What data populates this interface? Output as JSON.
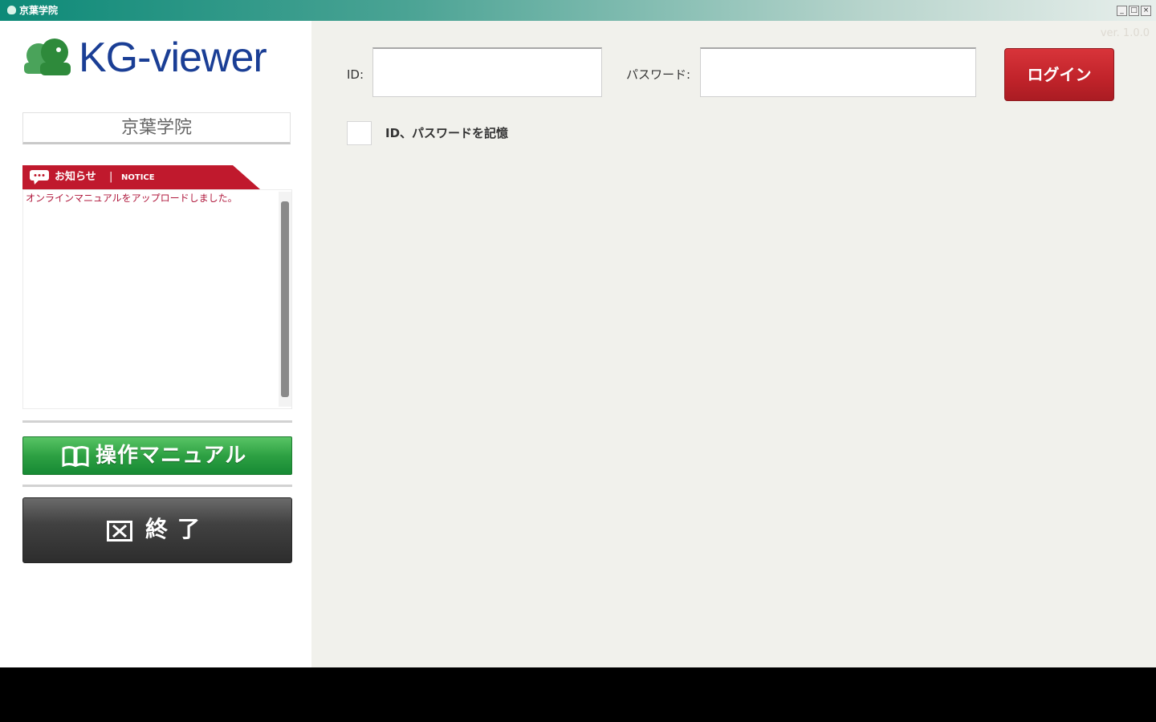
{
  "window": {
    "title": "京葉学院",
    "minimize_glyph": "_",
    "maximize_glyph": "□",
    "close_glyph": "×"
  },
  "sidebar": {
    "logo_text": "KG-viewer",
    "school_name": "京葉学院",
    "notice": {
      "tab_label": "お知らせ",
      "tab_separator": "|",
      "tab_label_en": "NOTICE",
      "messages": [
        "オンラインマニュアルをアップロードしました。"
      ]
    },
    "manual_button_label": "操作マニュアル",
    "exit_button_label": "終了"
  },
  "main": {
    "version": "ver. 1.0.0",
    "id_label": "ID:",
    "id_value": "",
    "password_label": "パスワード:",
    "password_value": "",
    "login_button_label": "ログイン",
    "remember_label": "ID、パスワードを記憶",
    "remember_checked": false
  },
  "colors": {
    "titlebar": "#0d8a78",
    "logo_text": "#1a3e95",
    "logo_mark": "#2e8a3b",
    "notice_header": "#c0192d",
    "notice_text": "#b0193d",
    "manual_button": "#2ea143",
    "exit_button": "#3a3a3a",
    "login_button": "#c0232a",
    "main_bg": "#f1f1ec"
  },
  "icons": {
    "notice": "speech-bubble-icon",
    "manual": "book-icon",
    "exit": "close-box-icon",
    "logo": "kg-heads-logo-icon"
  }
}
